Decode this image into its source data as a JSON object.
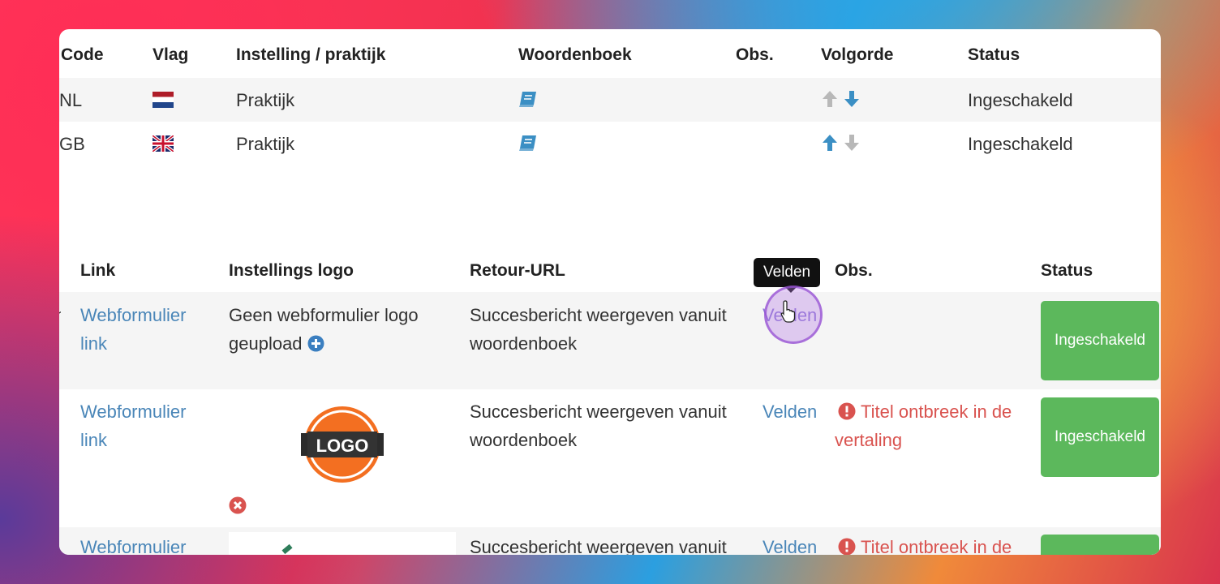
{
  "table1": {
    "headers": [
      "Code",
      "Vlag",
      "Instelling / praktijk",
      "Woordenboek",
      "Obs.",
      "Volgorde",
      "Status"
    ],
    "rows": [
      {
        "code": "NL",
        "type": "Praktijk",
        "status": "Ingeschakeld"
      },
      {
        "code": "GB",
        "type": "Praktijk",
        "status": "Ingeschakeld"
      }
    ]
  },
  "table2": {
    "headers": [
      "Link",
      "Instellings logo",
      "Retour-URL",
      "Obs.",
      "Status"
    ],
    "rows": [
      {
        "link": [
          "Webformulier",
          "link"
        ],
        "logo_text": [
          "Geen webformulier logo",
          "geupload"
        ],
        "retour": [
          "Succesbericht weergeven vanuit",
          "woordenboek"
        ],
        "velden": "Velden",
        "status": "Ingeschakeld"
      },
      {
        "link": [
          "Webformulier",
          "link"
        ],
        "logo_label": "LOGO",
        "retour": [
          "Succesbericht weergeven vanuit",
          "woordenboek"
        ],
        "velden": "Velden",
        "obs": [
          "Titel ontbreek in de",
          "vertaling"
        ],
        "status": "Ingeschakeld"
      },
      {
        "link": [
          "Webformulier"
        ],
        "retour": [
          "Succesbericht weergeven vanuit"
        ],
        "velden": "Velden",
        "obs": [
          "Titel ontbreek in de"
        ]
      }
    ]
  },
  "tooltip": "Velden",
  "colors": {
    "link": "#4a86b8",
    "success": "#5cb85c",
    "error": "#d9534f",
    "arrow_active": "#3b8fc4"
  }
}
